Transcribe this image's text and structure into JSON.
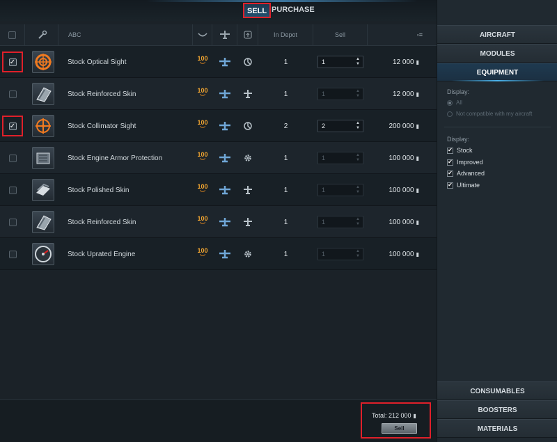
{
  "mode_tabs": {
    "sell": "SELL",
    "purchase": "PURCHASE"
  },
  "table": {
    "headers": {
      "name": "ABC",
      "depot": "In Depot",
      "sell": "Sell"
    },
    "rows": [
      {
        "checked": true,
        "icon": "optical-sight-icon",
        "name": "Stock Optical Sight",
        "tier": "100",
        "role": "crosshair",
        "depot": "1",
        "qty": "1",
        "qty_enabled": true,
        "price": "12 000"
      },
      {
        "checked": false,
        "icon": "reinforced-skin-icon",
        "name": "Stock Reinforced Skin",
        "tier": "100",
        "role": "plane",
        "depot": "1",
        "qty": "1",
        "qty_enabled": false,
        "price": "12 000"
      },
      {
        "checked": true,
        "icon": "collimator-sight-icon",
        "name": "Stock Collimator Sight",
        "tier": "100",
        "role": "crosshair",
        "depot": "2",
        "qty": "2",
        "qty_enabled": true,
        "price": "200 000"
      },
      {
        "checked": false,
        "icon": "engine-armor-icon",
        "name": "Stock Engine Armor Protection",
        "tier": "100",
        "role": "gear",
        "depot": "1",
        "qty": "1",
        "qty_enabled": false,
        "price": "100 000"
      },
      {
        "checked": false,
        "icon": "polished-skin-icon",
        "name": "Stock Polished Skin",
        "tier": "100",
        "role": "plane",
        "depot": "1",
        "qty": "1",
        "qty_enabled": false,
        "price": "100 000"
      },
      {
        "checked": false,
        "icon": "reinforced-skin-icon",
        "name": "Stock Reinforced Skin",
        "tier": "100",
        "role": "plane",
        "depot": "1",
        "qty": "1",
        "qty_enabled": false,
        "price": "100 000"
      },
      {
        "checked": false,
        "icon": "uprated-engine-icon",
        "name": "Stock Uprated Engine",
        "tier": "100",
        "role": "gear",
        "depot": "1",
        "qty": "1",
        "qty_enabled": false,
        "price": "100 000"
      }
    ]
  },
  "footer": {
    "total": "Total: 212 000",
    "sell_button": "Sell"
  },
  "right_panel": {
    "tabs_top": [
      "AIRCRAFT",
      "MODULES",
      "EQUIPMENT"
    ],
    "active_tab": "EQUIPMENT",
    "display_label_1": "Display:",
    "radio_all": "All",
    "radio_not_compatible": "Not compatible with my aircraft",
    "display_label_2": "Display:",
    "filters": [
      "Stock",
      "Improved",
      "Advanced",
      "Ultimate"
    ],
    "tabs_bottom": [
      "CONSUMABLES",
      "BOOSTERS",
      "MATERIALS"
    ]
  },
  "colors": {
    "highlight": "#e0202a",
    "tier": "#f0a430",
    "accent": "#4ab2ea"
  }
}
